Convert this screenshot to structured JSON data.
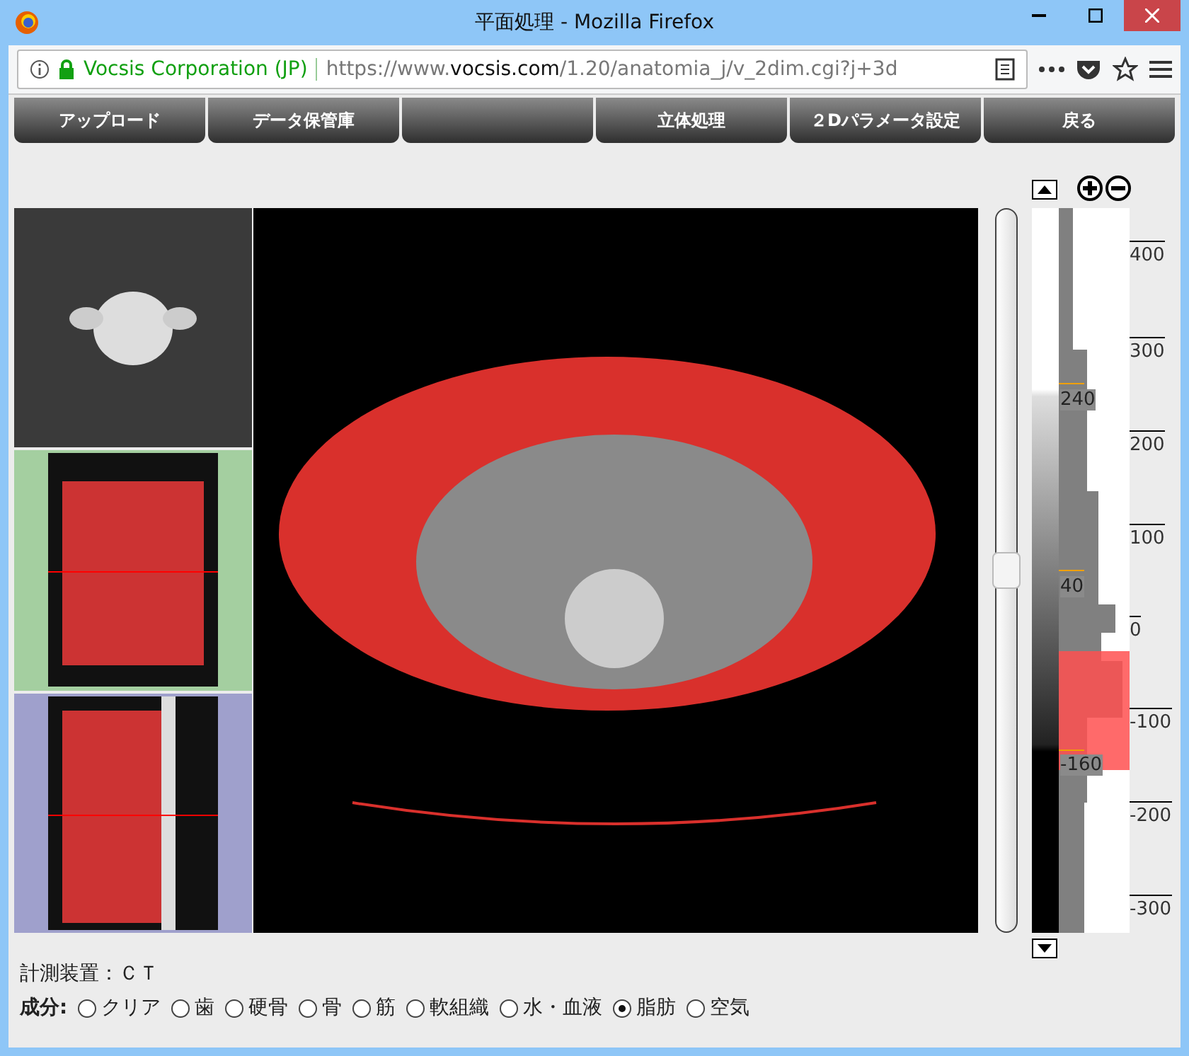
{
  "window": {
    "title": "平面処理 - Mozilla Firefox"
  },
  "address_bar": {
    "site_identity": "Vocsis Corporation (JP)",
    "url": {
      "prefix": "https://www.",
      "domain": "vocsis.com",
      "path": "/1.20/anatomia_j/v_2dim.cgi?j+3d"
    }
  },
  "nav_buttons": [
    {
      "kind": "text",
      "label": "アップロード"
    },
    {
      "kind": "text",
      "label": "データ保管庫"
    },
    {
      "kind": "blank"
    },
    {
      "kind": "text",
      "label": "立体処理"
    },
    {
      "kind": "text",
      "label": "２Dパラメータ設定"
    },
    {
      "kind": "text",
      "label": "戻る"
    }
  ],
  "slice_slider": {
    "level": 0.5
  },
  "window_markers": [
    "240",
    "40",
    "-160"
  ],
  "axis_ticks": [
    "400",
    "300",
    "200",
    "100",
    "0",
    "-100",
    "-200",
    "-300"
  ],
  "device": "計測装置：ＣＴ",
  "components": {
    "label": "成分:",
    "options": [
      {
        "label": "クリア",
        "selected": false
      },
      {
        "label": "歯",
        "selected": false
      },
      {
        "label": "硬骨",
        "selected": false
      },
      {
        "label": "骨",
        "selected": false
      },
      {
        "label": "筋",
        "selected": false
      },
      {
        "label": "軟組織",
        "selected": false
      },
      {
        "label": "水・血液",
        "selected": false
      },
      {
        "label": "脂肪",
        "selected": true
      },
      {
        "label": "空気",
        "selected": false
      }
    ]
  }
}
